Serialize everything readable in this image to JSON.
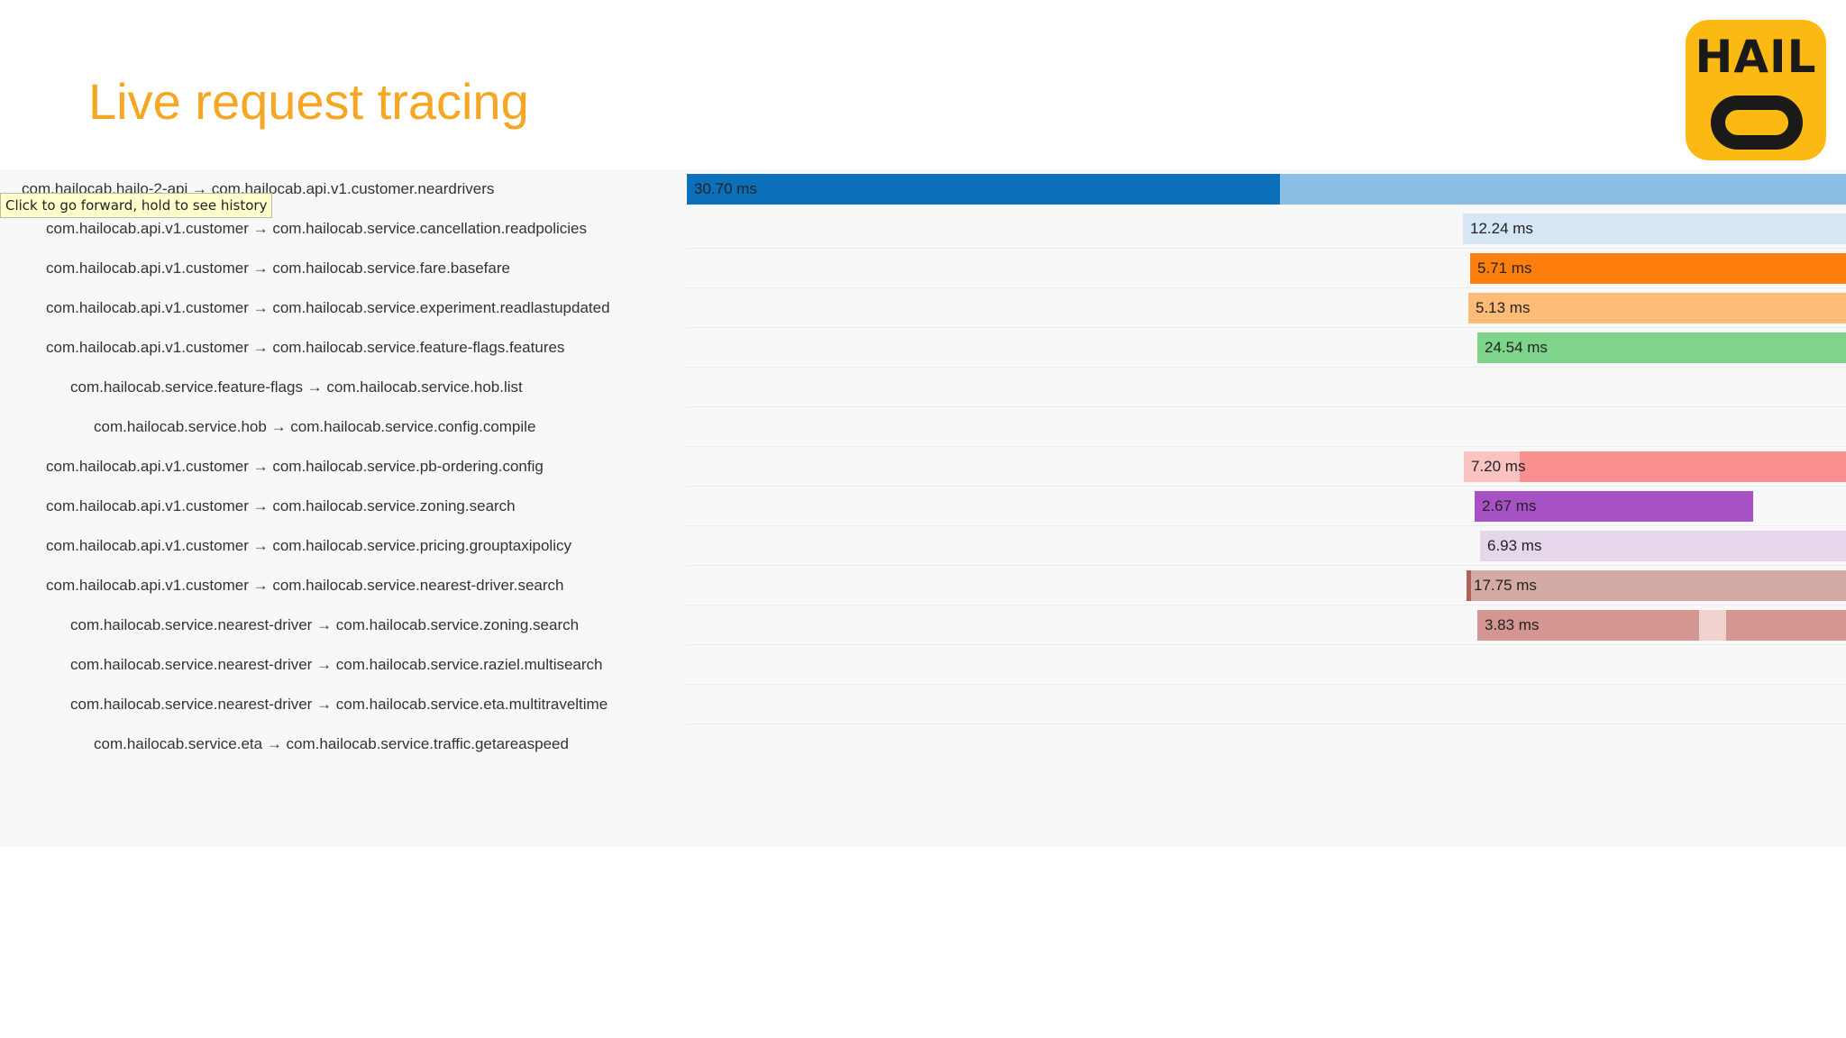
{
  "slide": {
    "title": "Live request tracing",
    "logo_text": "HAIL"
  },
  "tooltip": {
    "text": "Click to go forward, hold to see history"
  },
  "trace": {
    "rows": [
      {
        "label": "com.hailocab.hailo-2-api → com.hailocab.api.v1.customer.neardrivers",
        "duration": "30.70 ms",
        "color": "#8cbfe6"
      },
      {
        "label": "com.hailocab.api.v1.customer → com.hailocab.service.cancellation.readpolicies",
        "duration": "12.24 ms",
        "color": "#d7e6f5"
      },
      {
        "label": "com.hailocab.api.v1.customer → com.hailocab.service.fare.basefare",
        "duration": "5.71 ms",
        "color": "#ff7f0e"
      },
      {
        "label": "com.hailocab.api.v1.customer → com.hailocab.service.experiment.readlastupdated",
        "duration": "5.13 ms",
        "color": "#ffbb78"
      },
      {
        "label": "com.hailocab.api.v1.customer → com.hailocab.service.feature-flags.features",
        "duration": "24.54 ms",
        "color": "#7ed48a"
      },
      {
        "label": "com.hailocab.service.feature-flags → com.hailocab.service.hob.list",
        "duration": "",
        "color": ""
      },
      {
        "label": "com.hailocab.service.hob → com.hailocab.service.config.compile",
        "duration": "",
        "color": ""
      },
      {
        "label": "com.hailocab.api.v1.customer → com.hailocab.service.pb-ordering.config",
        "duration": "7.20 ms",
        "color": "#f98f8f"
      },
      {
        "label": "com.hailocab.api.v1.customer → com.hailocab.service.zoning.search",
        "duration": "2.67 ms",
        "color": "#a652c4"
      },
      {
        "label": "com.hailocab.api.v1.customer → com.hailocab.service.pricing.grouptaxipolicy",
        "duration": "6.93 ms",
        "color": "#e6d6ec"
      },
      {
        "label": "com.hailocab.api.v1.customer → com.hailocab.service.nearest-driver.search",
        "duration": "17.75 ms",
        "color": "#d4aba4"
      },
      {
        "label": "com.hailocab.service.nearest-driver → com.hailocab.service.zoning.search",
        "duration": "3.83 ms",
        "color": "#d49690"
      },
      {
        "label": "com.hailocab.service.nearest-driver → com.hailocab.service.raziel.multisearch",
        "duration": "",
        "color": ""
      },
      {
        "label": "com.hailocab.service.nearest-driver → com.hailocab.service.eta.multitraveltime",
        "duration": "",
        "color": ""
      },
      {
        "label": "com.hailocab.service.eta → com.hailocab.service.traffic.getareaspeed",
        "duration": "",
        "color": ""
      }
    ]
  }
}
